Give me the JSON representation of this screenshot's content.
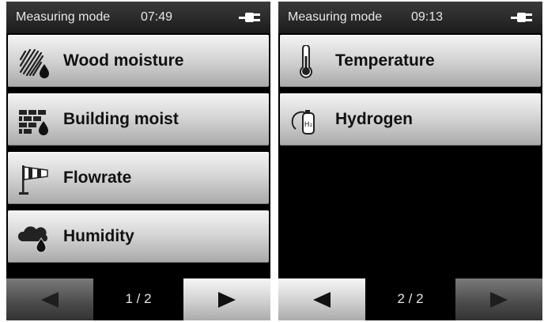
{
  "screen1": {
    "status": {
      "title": "Measuring mode",
      "time": "07:49",
      "icon": "power-plug-icon"
    },
    "menu": [
      {
        "label": "Wood moisture",
        "icon": "wood-moisture-icon"
      },
      {
        "label": "Building moist",
        "icon": "building-moisture-icon"
      },
      {
        "label": "Flowrate",
        "icon": "windsock-icon"
      },
      {
        "label": "Humidity",
        "icon": "cloud-drop-icon"
      }
    ],
    "nav": {
      "page": "1 / 2",
      "prev_enabled": false,
      "next_enabled": true
    }
  },
  "screen2": {
    "status": {
      "title": "Measuring mode",
      "time": "09:13",
      "icon": "power-plug-icon"
    },
    "menu": [
      {
        "label": "Temperature",
        "icon": "thermometer-icon"
      },
      {
        "label": "Hydrogen",
        "icon": "hydrogen-cylinder-icon"
      }
    ],
    "nav": {
      "page": "2 / 2",
      "prev_enabled": true,
      "next_enabled": false
    }
  },
  "colors": {
    "status_bar": "#2a2a2a",
    "status_text": "#e6e6e6",
    "button_light": "#f4f4f4",
    "button_dark": "#a9a9a9",
    "arrow_enabled": "#111111",
    "arrow_disabled": "#1e1e1e",
    "background": "#000000"
  }
}
